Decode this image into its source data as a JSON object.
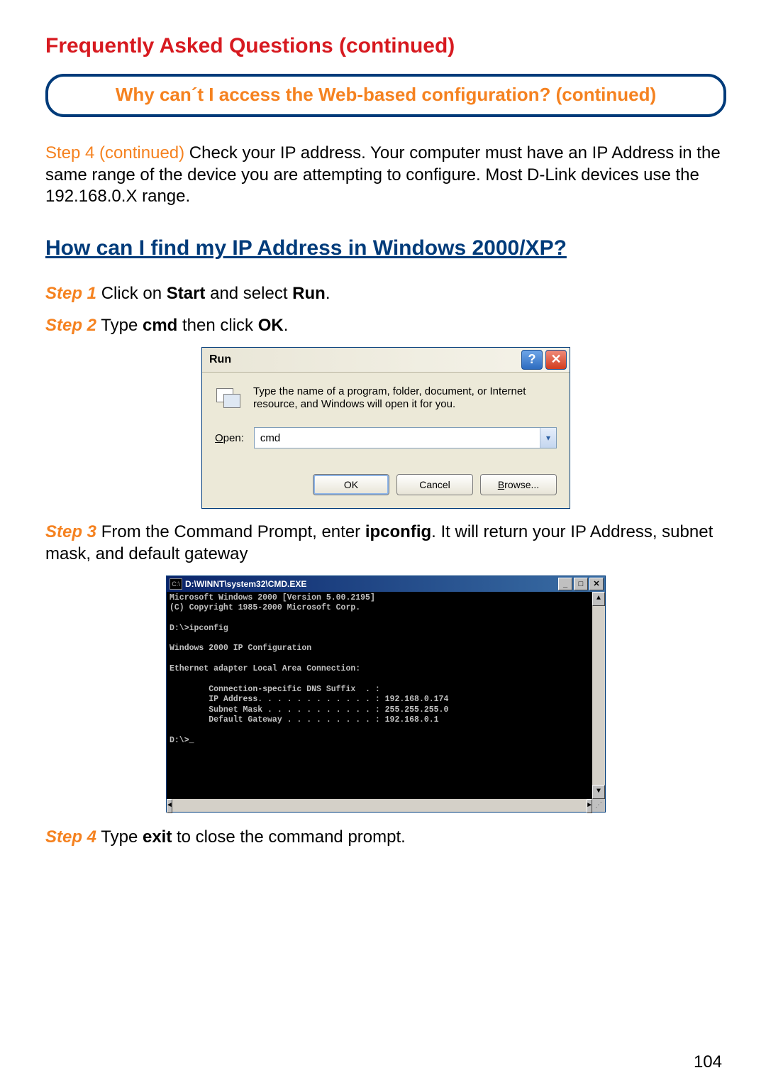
{
  "faq_title": "Frequently Asked Questions (continued)",
  "section_title": "Why can´t I access the Web-based configuration? (continued)",
  "step4_continued": {
    "label": "Step 4 (continued)",
    "text": " Check your IP address. Your computer must have an IP Address in the same range of the device you are attempting to configure. Most D-Link devices use the 192.168.0.X range."
  },
  "subheading": "How can I find my IP Address in Windows 2000/XP?",
  "steps": {
    "s1": {
      "label": "Step 1",
      "pre": " Click on ",
      "b1": "Start",
      "mid": " and select ",
      "b2": "Run",
      "post": "."
    },
    "s2": {
      "label": "Step 2",
      "pre": " Type ",
      "b1": "cmd",
      "mid": " then click ",
      "b2": "OK",
      "post": "."
    },
    "s3": {
      "label": "Step 3",
      "pre": " From the Command Prompt, enter ",
      "b1": "ipconfig",
      "post": ". It will return your IP Address, subnet mask, and default gateway"
    },
    "s4": {
      "label": "Step 4",
      "pre": " Type ",
      "b1": "exit",
      "post": " to close the command prompt."
    }
  },
  "run_dialog": {
    "title": "Run",
    "help": "?",
    "close": "✕",
    "description": "Type the name of a program, folder, document, or Internet resource, and Windows will open it for you.",
    "open_label_u": "O",
    "open_label_rest": "pen:",
    "value": "cmd",
    "ok": "OK",
    "cancel": "Cancel",
    "browse_u": "B",
    "browse_rest": "rowse..."
  },
  "cmd": {
    "title": "D:\\WINNT\\system32\\CMD.EXE",
    "content": "Microsoft Windows 2000 [Version 5.00.2195]\n(C) Copyright 1985-2000 Microsoft Corp.\n\nD:\\>ipconfig\n\nWindows 2000 IP Configuration\n\nEthernet adapter Local Area Connection:\n\n        Connection-specific DNS Suffix  . :\n        IP Address. . . . . . . . . . . . : 192.168.0.174\n        Subnet Mask . . . . . . . . . . . : 255.255.255.0\n        Default Gateway . . . . . . . . . : 192.168.0.1\n\nD:\\>_"
  },
  "page_number": "104"
}
